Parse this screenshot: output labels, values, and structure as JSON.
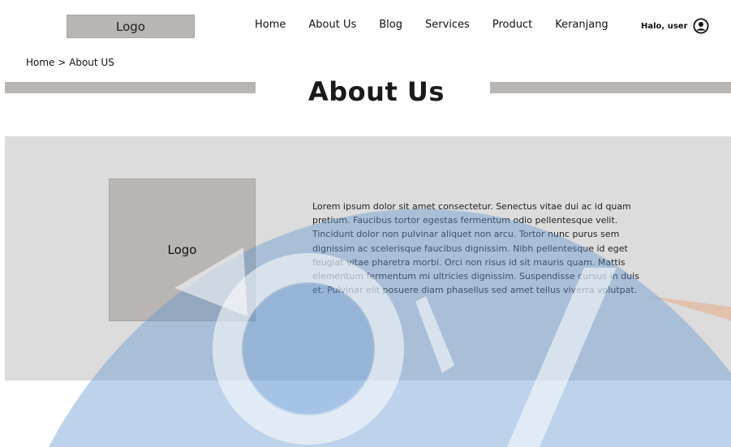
{
  "header": {
    "logo_label": "Logo",
    "nav": [
      "Home",
      "About Us",
      "Blog",
      "Services",
      "Product",
      "Keranjang"
    ],
    "user_greeting": "Halo, user",
    "user_icon": "user-circle-icon"
  },
  "breadcrumb": "Home > About US",
  "page_title": "About Us",
  "about": {
    "logo_label": "Logo",
    "text": "Lorem ipsum dolor sit amet consectetur. Senectus vitae dui ac id quam pretium. Faucibus tortor egestas fermentum odio pellentesque velit. Tincidunt dolor non pulvinar aliquet non arcu. Tortor nunc purus sem dignissim ac scelerisque faucibus dignissim. Nibh pellentesque id eget feugiat vitae pharetra morbi. Orci non risus id sit mauris quam. Mattis elementum fermentum mi ultricies dignissim. Suspendisse cursus in duis et. Pulvinar elit posuere diam phasellus sed amet tellus viverra volutpat."
  },
  "colors": {
    "placeholder_gray": "#b9b5b3",
    "section_bg": "#dcdcdc",
    "watermark_blue": "#5f95cf",
    "watermark_orange": "#e8a070"
  }
}
